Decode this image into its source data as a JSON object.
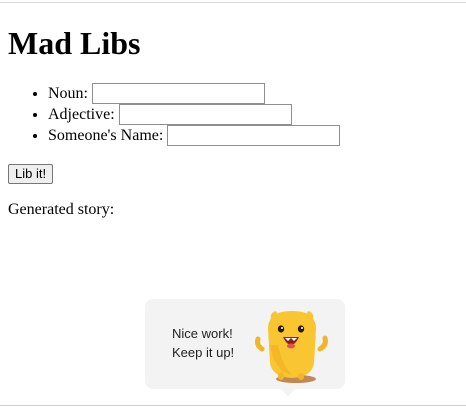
{
  "page": {
    "title": "Mad Libs"
  },
  "fields": [
    {
      "label": "Noun:",
      "value": "",
      "placeholder": ""
    },
    {
      "label": "Adjective:",
      "value": "",
      "placeholder": ""
    },
    {
      "label": "Someone's Name:",
      "value": "",
      "placeholder": ""
    }
  ],
  "actions": {
    "lib_button_label": "Lib it!"
  },
  "story": {
    "label": "Generated story:",
    "text": ""
  },
  "toast": {
    "line1": "Nice work!",
    "line2": "Keep it up!",
    "mascot_icon": "yellow-monster-mascot-icon",
    "mascot_color": "#f9c531"
  }
}
